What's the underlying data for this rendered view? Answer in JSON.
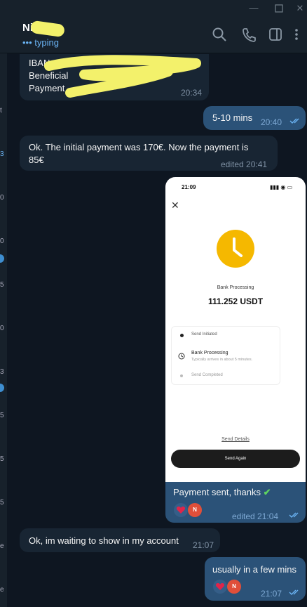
{
  "window": {
    "min_icon": "minimize-icon",
    "max_icon": "maximize-icon",
    "close_icon": "close-icon"
  },
  "header": {
    "name": "Ni",
    "status": "typing",
    "typing_dots": "•••"
  },
  "left_strip": {
    "marks": [
      "t",
      "3",
      "0",
      "0",
      "5",
      "0",
      "3",
      "5",
      "5",
      "5",
      "e",
      "e"
    ]
  },
  "messages": [
    {
      "id": "m1",
      "dir": "in",
      "lines": [
        "IBAN:",
        "Beneficial",
        "Payment"
      ],
      "time": "20:34"
    },
    {
      "id": "m2",
      "dir": "out",
      "text": "5-10 mins",
      "time": "20:40"
    },
    {
      "id": "m3",
      "dir": "in",
      "lines": [
        "Ok. The initial payment was 170€. Now the payment is",
        "85€"
      ],
      "time": "edited 20:41"
    },
    {
      "id": "m4",
      "dir": "out",
      "caption": "Payment sent, thanks",
      "emoji": "✔",
      "time": "edited 21:04",
      "reaction_avatar": "N"
    },
    {
      "id": "m5",
      "dir": "in",
      "text": "Ok, im waiting to show in my account",
      "time": "21:07"
    },
    {
      "id": "m6",
      "dir": "out",
      "text": "usually in a few mins",
      "time": "21:07",
      "reaction_avatar": "N"
    }
  ],
  "phone": {
    "status_time": "21:09",
    "title": "Bank Processing",
    "amount": "111.252 USDT",
    "steps": [
      {
        "label": "Send Initiated",
        "sub": ""
      },
      {
        "label": "Bank Processing",
        "sub": "Typically arrives in about 5 minutes."
      },
      {
        "label": "Send Completed",
        "sub": ""
      }
    ],
    "details_link": "Send Details",
    "button": "Send Again",
    "accent": "#f5b800"
  },
  "colors": {
    "bg": "#0e1621",
    "incoming": "#182533",
    "outgoing": "#2b5278",
    "link": "#6ab3f3"
  }
}
